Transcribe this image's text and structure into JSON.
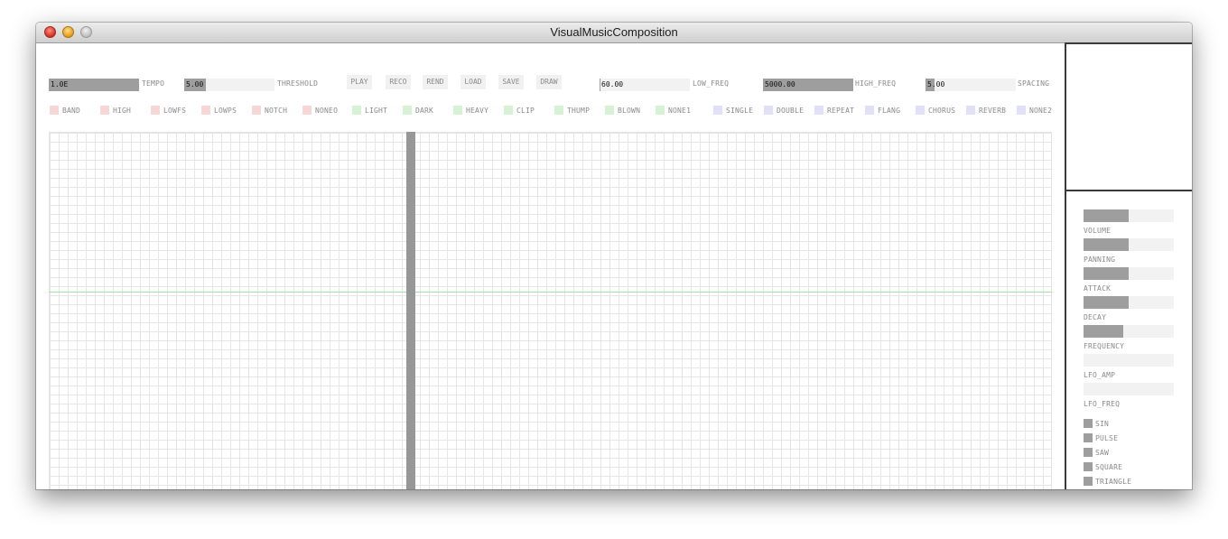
{
  "window": {
    "title": "VisualMusicComposition"
  },
  "sliders": [
    {
      "id": "tempo",
      "value": "1.0E",
      "label": "TEMPO",
      "fill": 1.0
    },
    {
      "id": "threshold",
      "value": "5.00",
      "label": "THRESHOLD",
      "fill": 0.24
    },
    {
      "id": "low_freq",
      "value": "60.00",
      "label": "LOW_FREQ",
      "fill": 0.01
    },
    {
      "id": "high_freq",
      "value": "5000.00",
      "label": "HIGH_FREQ",
      "fill": 1.0
    },
    {
      "id": "spacing",
      "value": "5.00",
      "label": "SPACING",
      "fill": 0.1
    }
  ],
  "buttons": [
    "PLAY",
    "RECO",
    "REND",
    "LOAD",
    "SAVE",
    "DRAW"
  ],
  "filters": {
    "color": "#f8d6d6",
    "items": [
      "BAND",
      "HIGH",
      "LOWFS",
      "LOWPS",
      "NOTCH",
      "NONEO"
    ]
  },
  "tones": {
    "color": "#d6f3d6",
    "items": [
      "LIGHT",
      "DARK",
      "HEAVY",
      "CLIP",
      "THUMP",
      "BLOWN",
      "NONE1"
    ]
  },
  "effects": {
    "color": "#e0e0f8",
    "items": [
      "SINGLE",
      "DOUBLE",
      "REPEAT",
      "FLANG",
      "CHORUS",
      "REVERB",
      "NONE2"
    ]
  },
  "colors": {
    "slider_fill": "#9e9e9e",
    "slider_bg": "#f2f2f2",
    "grid_line": "#e6e6e6",
    "center_line": "#9fe39f",
    "playhead": "#979797",
    "divider": "#3a3a3a"
  },
  "params": [
    {
      "label": "VOLUME",
      "fill": 0.5
    },
    {
      "label": "PANNING",
      "fill": 0.5
    },
    {
      "label": "ATTACK",
      "fill": 0.5
    },
    {
      "label": "DECAY",
      "fill": 0.5
    },
    {
      "label": "FREQUENCY",
      "fill": 0.44
    },
    {
      "label": "LFO_AMP",
      "fill": 0.0
    },
    {
      "label": "LFO_FREQ",
      "fill": 0.0
    }
  ],
  "waveforms": [
    "SIN",
    "PULSE",
    "SAW",
    "SQUARE",
    "TRIANGLE"
  ]
}
